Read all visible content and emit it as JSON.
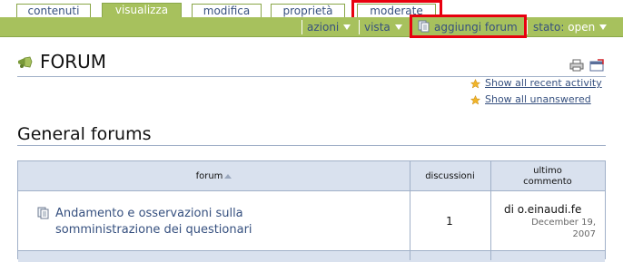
{
  "tabs": [
    {
      "label": "contenuti"
    },
    {
      "label": "visualizza",
      "active": true
    },
    {
      "label": "modifica"
    },
    {
      "label": "proprietà"
    },
    {
      "label": "moderate"
    }
  ],
  "actionbar": {
    "azioni": "azioni",
    "vista": "vista",
    "add_forum": "aggiungi forum",
    "stato_label": "stato:",
    "stato_value": "open"
  },
  "forum": {
    "title": "FORUM",
    "link_recent": "Show all recent activity",
    "link_unanswered": "Show all unanswered"
  },
  "section": {
    "title": "General forums"
  },
  "table": {
    "headers": {
      "forum": "forum",
      "discussions": "discussioni",
      "last_comment_line1": "ultimo",
      "last_comment_line2": "commento"
    },
    "rows": [
      {
        "name_line1": "Andamento e osservazioni sulla",
        "name_line2": "somministrazione dei questionari",
        "discussions": "1",
        "last_by": "di o.einaudi.fe",
        "last_date1": "December 19,",
        "last_date2": "2007"
      }
    ]
  },
  "colors": {
    "tab_green": "#a7c15d",
    "link_blue": "#36507f",
    "header_bg": "#d9e1ee",
    "highlight_red": "#e8000f"
  }
}
